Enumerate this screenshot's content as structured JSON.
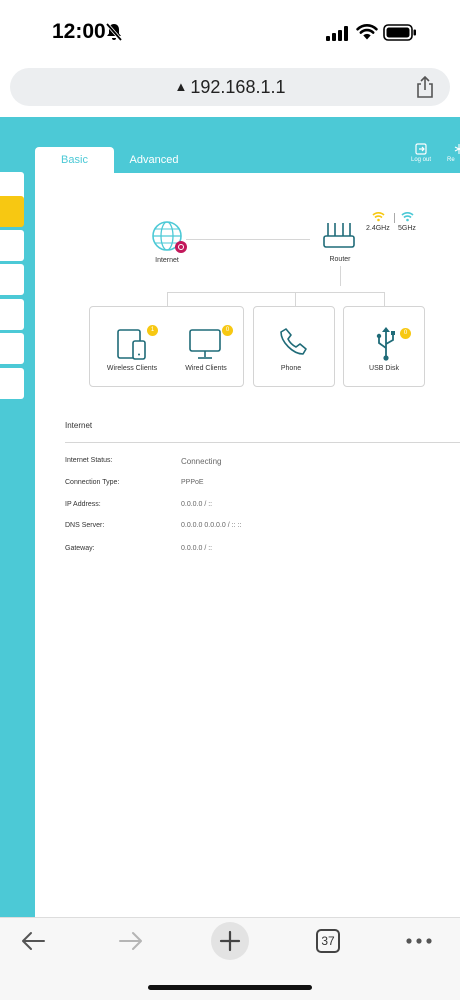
{
  "status_bar": {
    "time": "12:00",
    "icons": [
      "bell-slash-icon",
      "signal-icon",
      "wifi-icon",
      "battery-icon"
    ]
  },
  "browser": {
    "url": "192.168.1.1",
    "security_icon": "warning-icon",
    "share_icon": "share-icon",
    "tab_count": "37",
    "toolbar_icons": [
      "back-arrow-icon",
      "forward-arrow-icon",
      "new-tab-plus-icon",
      "tab-count-icon",
      "more-icon"
    ]
  },
  "router": {
    "theme_color": "#4cc9d6",
    "accent_color": "#f7c812",
    "tabs": [
      {
        "label": "Basic",
        "active": true
      },
      {
        "label": "Advanced",
        "active": false
      }
    ],
    "top_actions": {
      "logout": "Log out",
      "reboot": "Re"
    },
    "diagram": {
      "internet_label": "Internet",
      "router_label": "Router",
      "bands": [
        "2.4GHz",
        "5GHz"
      ]
    },
    "cards": [
      {
        "label": "Wireless Clients",
        "badge": "1"
      },
      {
        "label": "Wired Clients",
        "badge": "0"
      },
      {
        "label": "Phone",
        "badge": ""
      },
      {
        "label": "USB Disk",
        "badge": "0"
      }
    ],
    "section_title": "Internet",
    "rows": [
      {
        "label": "Internet Status:",
        "value": "Connecting"
      },
      {
        "label": "Connection Type:",
        "value": "PPPoE"
      },
      {
        "label": "IP Address:",
        "value": "0.0.0.0 / ::"
      },
      {
        "label": "DNS Server:",
        "value": "0.0.0.0 0.0.0.0 / :: ::"
      },
      {
        "label": "Gateway:",
        "value": "0.0.0.0 / ::"
      }
    ]
  }
}
